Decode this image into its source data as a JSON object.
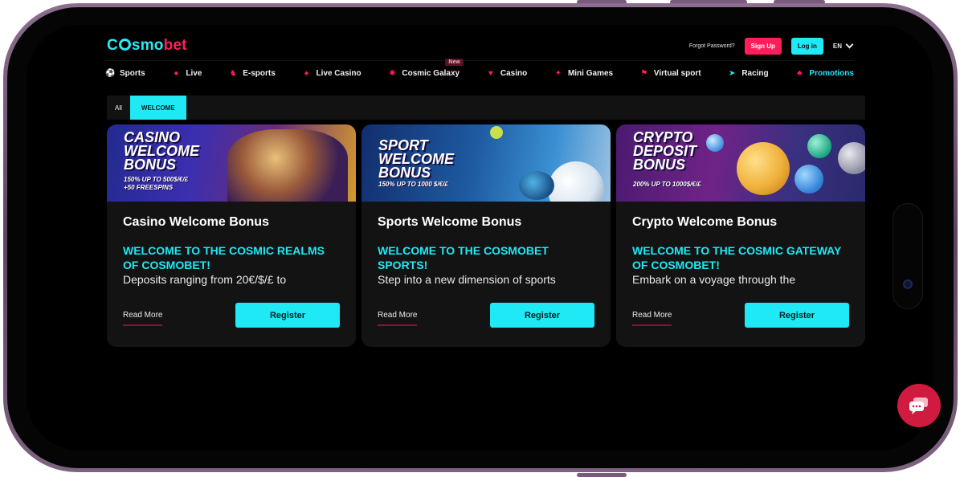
{
  "brand": {
    "logo_prefix": "C",
    "logo_mid": "smo",
    "logo_suffix": "bet"
  },
  "header": {
    "forgot_password": "Forgot Password?",
    "signup": "Sign Up",
    "login": "Log in",
    "language": "EN"
  },
  "nav": {
    "items": [
      {
        "label": "Sports",
        "icon": "soccer-ball-icon"
      },
      {
        "label": "Live",
        "icon": "live-dot-icon"
      },
      {
        "label": "E-sports",
        "icon": "esports-icon"
      },
      {
        "label": "Live Casino",
        "icon": "cards-icon"
      },
      {
        "label": "Cosmic Galaxy",
        "icon": "galaxy-icon",
        "badge": "New"
      },
      {
        "label": "Casino",
        "icon": "cherry-icon"
      },
      {
        "label": "Mini Games",
        "icon": "minigames-icon"
      },
      {
        "label": "Virtual sport",
        "icon": "flag-icon"
      },
      {
        "label": "Racing",
        "icon": "racing-icon"
      },
      {
        "label": "Promotions",
        "icon": "gift-icon"
      }
    ]
  },
  "filters": {
    "all": "All",
    "welcome": "WELCOME"
  },
  "cards": [
    {
      "banner_title": "CASINO WELCOME BONUS",
      "banner_sub_1": "150% UP TO 500$/€/£",
      "banner_sub_2": "+50 FREESPINS",
      "title": "Casino Welcome Bonus",
      "kicker": "WELCOME TO THE COSMIC REALMS OF COSMOBET!",
      "desc": "Deposits ranging from 20€/$/£ to",
      "read_more": "Read More",
      "register": "Register"
    },
    {
      "banner_title": "SPORT WELCOME BONUS",
      "banner_sub_1": "150% UP TO 1000 $/€/£",
      "title": "Sports Welcome Bonus",
      "kicker": "WELCOME TO THE COSMOBET SPORTS!",
      "desc": "Step into a new dimension of sports",
      "read_more": "Read More",
      "register": "Register"
    },
    {
      "banner_title": "CRYPTO DEPOSIT BONUS",
      "banner_sub_1": "200% UP TO 1000$/€/£",
      "title": "Crypto Welcome Bonus",
      "kicker": "WELCOME TO THE COSMIC GATEWAY OF COSMOBET!",
      "desc": "Embark on a voyage through the",
      "read_more": "Read More",
      "register": "Register"
    }
  ],
  "colors": {
    "accent": "#1ee9f5",
    "brand_red": "#ff1e5a",
    "background": "#000000",
    "card": "#131313"
  }
}
